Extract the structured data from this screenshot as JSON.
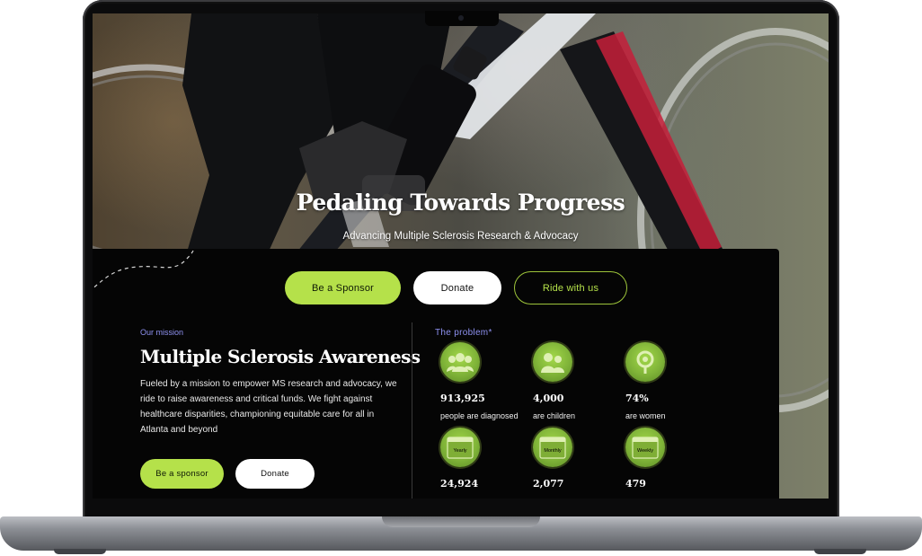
{
  "hero": {
    "title": "Pedaling Towards Progress",
    "subtitle": "Advancing Multiple Sclerosis Research & Advocacy"
  },
  "cta": {
    "sponsor": "Be a Sponsor",
    "donate": "Donate",
    "ride": "Ride with us"
  },
  "mission": {
    "eyebrow": "Our mission",
    "title": "Multiple Sclerosis Awareness",
    "body": "Fueled by a mission to empower MS research and advocacy, we ride to raise awareness and critical funds. We fight against healthcare disparities, championing equitable care for all in Atlanta and beyond",
    "sponsor_button": "Be a sponsor",
    "donate_button": "Donate"
  },
  "problem": {
    "eyebrow": "The problem*",
    "stats": [
      {
        "value": "913,925",
        "caption": "people are diagnosed",
        "icon": "group-icon"
      },
      {
        "value": "4,000",
        "caption": "are children",
        "icon": "children-icon"
      },
      {
        "value": "74%",
        "caption": "are women",
        "icon": "female-icon"
      },
      {
        "value": "24,924",
        "caption": "",
        "icon": "calendar-icon",
        "period": "Yearly"
      },
      {
        "value": "2,077",
        "caption": "",
        "icon": "calendar-icon",
        "period": "Monthly"
      },
      {
        "value": "479",
        "caption": "",
        "icon": "calendar-icon",
        "period": "Weekly"
      }
    ]
  },
  "colors": {
    "accent": "#b5e14a",
    "eyebrow": "#8f92f2",
    "panel": "#050505"
  }
}
